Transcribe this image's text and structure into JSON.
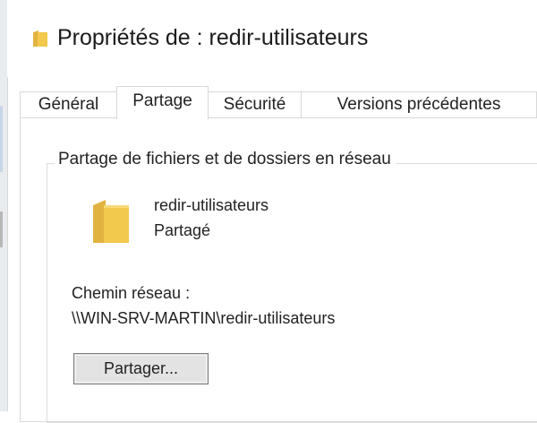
{
  "window": {
    "title": "Propriétés de : redir-utilisateurs"
  },
  "tabs": [
    {
      "label": "Général",
      "active": false
    },
    {
      "label": "Partage",
      "active": true
    },
    {
      "label": "Sécurité",
      "active": false
    },
    {
      "label": "Versions précédentes",
      "active": false
    }
  ],
  "share_group": {
    "legend": "Partage de fichiers et de dossiers en réseau",
    "folder_name": "redir-utilisateurs",
    "folder_status": "Partagé",
    "network_path_label": "Chemin réseau :",
    "network_path": "\\\\WIN-SRV-MARTIN\\redir-utilisateurs",
    "share_button_label": "Partager..."
  },
  "icons": {
    "title": "folder-icon",
    "folder": "folder-icon"
  },
  "colors": {
    "folder": "#f2c94c",
    "folder_dark": "#e3b341",
    "button_bg": "#e3e3e3",
    "button_border": "#7a7a7a"
  }
}
